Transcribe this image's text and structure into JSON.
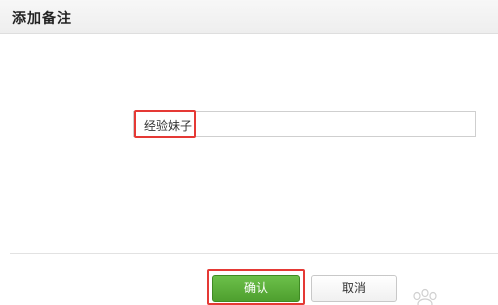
{
  "dialog": {
    "title": "添加备注"
  },
  "remark_input": {
    "value": "经验妹子"
  },
  "buttons": {
    "confirm_label": "确认",
    "cancel_label": "取消"
  },
  "colors": {
    "confirm_button": "#4e9f2e",
    "highlight": "#e53935",
    "header_background": "#eeeeee"
  },
  "icons": {
    "watermark": "paw-icon"
  }
}
